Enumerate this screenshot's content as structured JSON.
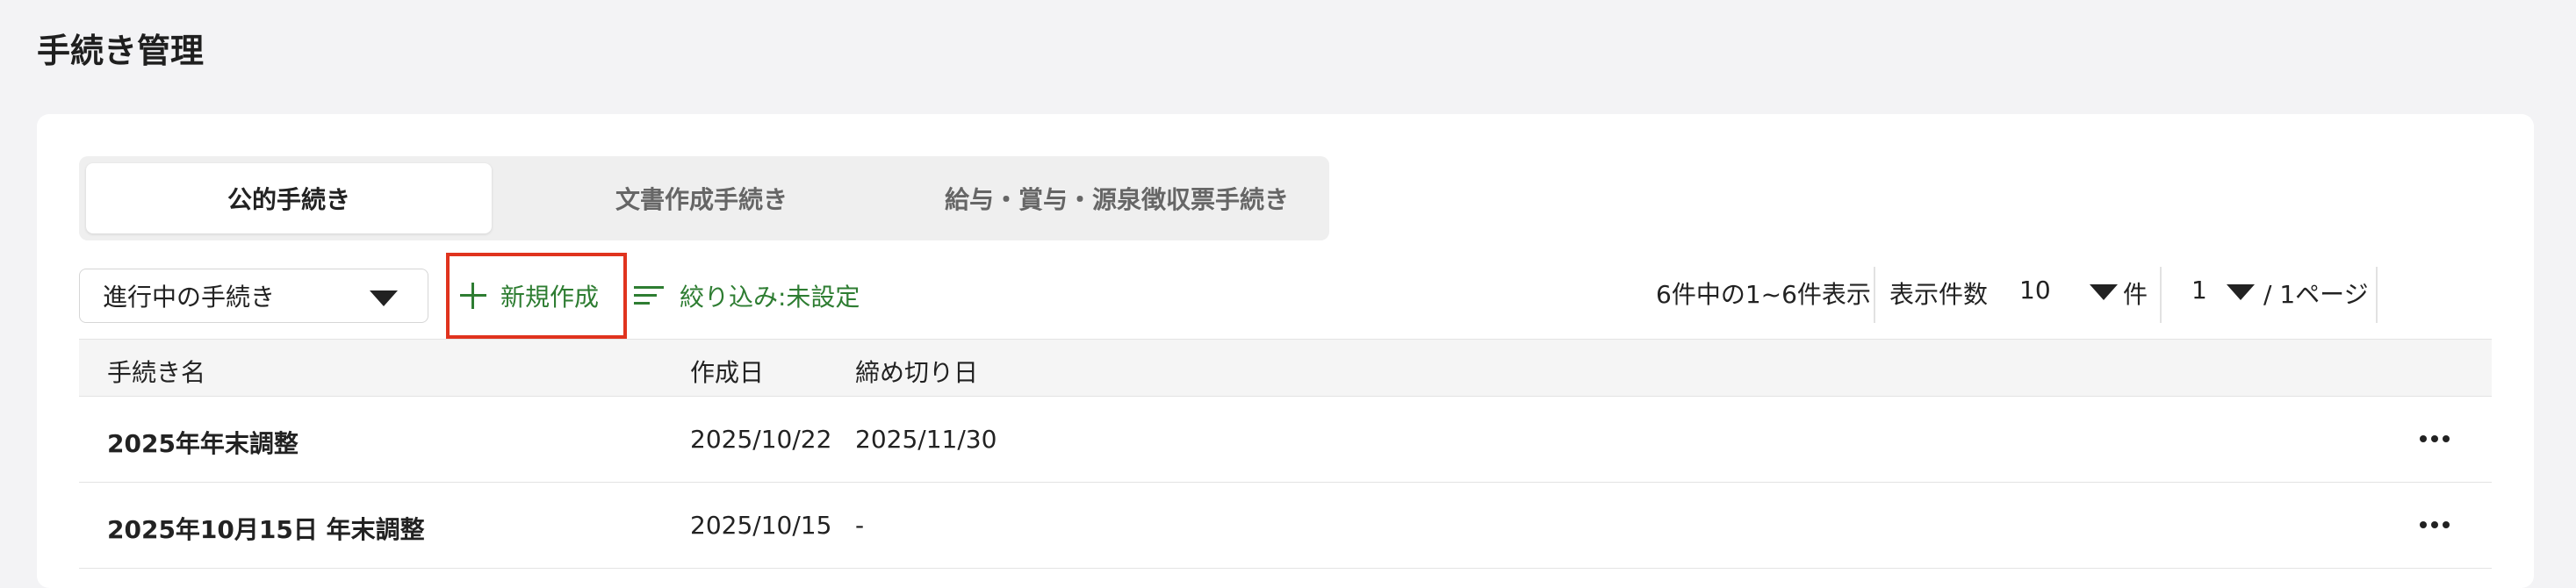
{
  "page": {
    "title": "手続き管理"
  },
  "tabs": [
    {
      "label": "公的手続き",
      "active": true
    },
    {
      "label": "文書作成手続き",
      "active": false
    },
    {
      "label": "給与・賞与・源泉徴収票手続き",
      "active": false
    }
  ],
  "toolbar": {
    "status_select": "進行中の手続き",
    "new_button": "新規作成",
    "filter_button": "絞り込み:未設定",
    "accent_color": "#2e7d32",
    "highlight_color": "#e0331e"
  },
  "pagination": {
    "summary": "6件中の1~6件表示",
    "per_page_label": "表示件数",
    "per_page_value": "10",
    "per_page_unit": "件",
    "current_page": "1",
    "total_pages_text": "/ 1ページ"
  },
  "table": {
    "columns": [
      "手続き名",
      "作成日",
      "締め切り日"
    ],
    "rows": [
      {
        "name": "2025年年末調整",
        "created": "2025/10/22",
        "deadline": "2025/11/30"
      },
      {
        "name": "2025年10月15日 年末調整",
        "created": "2025/10/15",
        "deadline": "-"
      }
    ]
  }
}
